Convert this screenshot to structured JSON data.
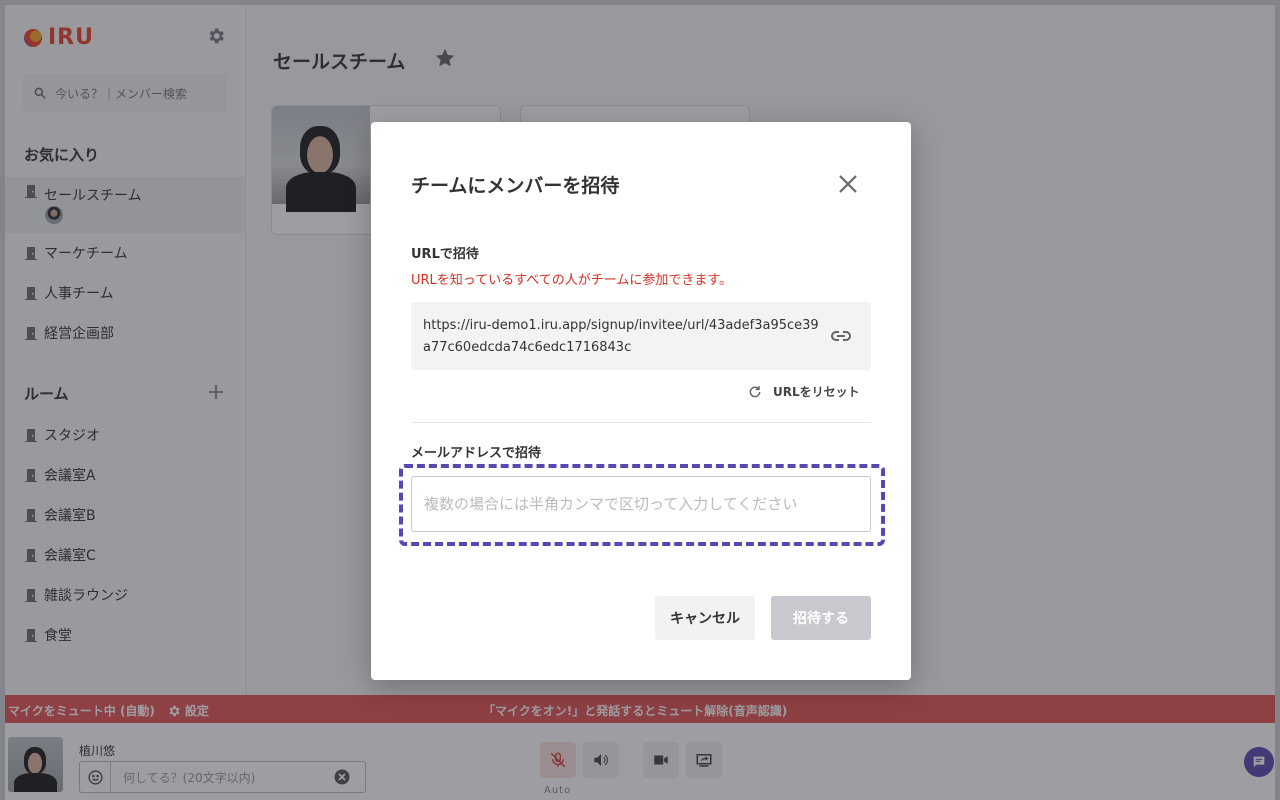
{
  "app": {
    "logo_text": "IRU"
  },
  "sidebar": {
    "search_placeholder": "今いる？｜メンバー検索",
    "favorites_title": "お気に入り",
    "favorites": [
      {
        "label": "セールスチーム"
      },
      {
        "label": "マーケチーム"
      },
      {
        "label": "人事チーム"
      },
      {
        "label": "経営企画部"
      }
    ],
    "rooms_title": "ルーム",
    "rooms": [
      {
        "label": "スタジオ"
      },
      {
        "label": "会議室A"
      },
      {
        "label": "会議室B"
      },
      {
        "label": "会議室C"
      },
      {
        "label": "雑談ラウンジ"
      },
      {
        "label": "食堂"
      }
    ]
  },
  "main": {
    "title": "セールスチーム"
  },
  "mute_bar": {
    "status": "マイクをミュート中 (自動)",
    "settings_label": "設定",
    "hint": "「マイクをオン!」と発話するとミュート解除(音声認識)",
    "color": "#e35555"
  },
  "footer": {
    "user_name": "植川悠",
    "status_placeholder": "何してる？(20文字以内)",
    "mic_mode": "Auto"
  },
  "modal": {
    "title": "チームにメンバーを招待",
    "url_section_label": "URLで招待",
    "url_warning": "URLを知っているすべての人がチームに参加できます。",
    "invite_url": "https://iru-demo1.iru.app/signup/invitee/url/43adef3a95ce39a77c60edcda74c6edc1716843c",
    "reset_label": "URLをリセット",
    "email_section_label": "メールアドレスで招待",
    "email_value": "",
    "email_placeholder": "複数の場合には半角カンマで区切って入力してください",
    "cancel_label": "キャンセル",
    "invite_label": "招待する",
    "accent_color": "#5b45b0"
  }
}
